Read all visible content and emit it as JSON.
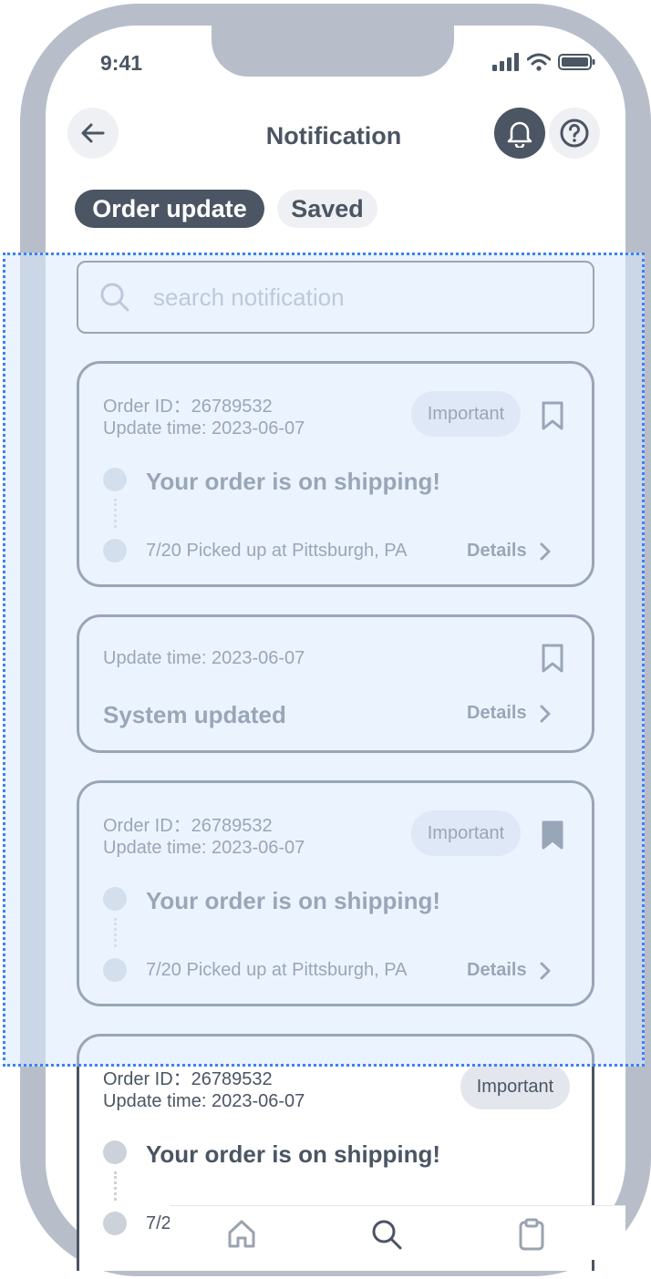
{
  "status": {
    "time": "9:41"
  },
  "header": {
    "title": "Notification"
  },
  "tabs": [
    {
      "label": "Order update",
      "active": true
    },
    {
      "label": "Saved",
      "active": false
    }
  ],
  "search": {
    "placeholder": "search notification"
  },
  "cards": [
    {
      "order_id": "Order ID：26789532",
      "update_time": "Update time:  2023-06-07",
      "badge": "Important",
      "bookmark": "bookmark-outline",
      "headline": "Your order is on shipping!",
      "step": "7/20 Picked up at Pittsburgh, PA",
      "details": "Details"
    },
    {
      "update_time": "Update time:  2023-06-07",
      "bookmark": "bookmark-outline",
      "headline": "System updated",
      "details": "Details"
    },
    {
      "order_id": "Order ID：26789532",
      "update_time": "Update time:  2023-06-07",
      "badge": "Important",
      "bookmark": "bookmark-filled",
      "headline": "Your order is on shipping!",
      "step": "7/20 Picked up at Pittsburgh, PA",
      "details": "Details"
    },
    {
      "order_id": "Order ID：26789532",
      "update_time": "Update time:  2023-06-07",
      "badge": "Important",
      "headline": "Your order is on shipping!",
      "step": "7/2"
    }
  ],
  "bottom_nav": {
    "items": [
      "home-icon",
      "search-icon",
      "clipboard-icon"
    ]
  },
  "colors": {
    "primary": "#4b5563",
    "frame": "#b8bec9",
    "highlight": "#3b82f6"
  }
}
